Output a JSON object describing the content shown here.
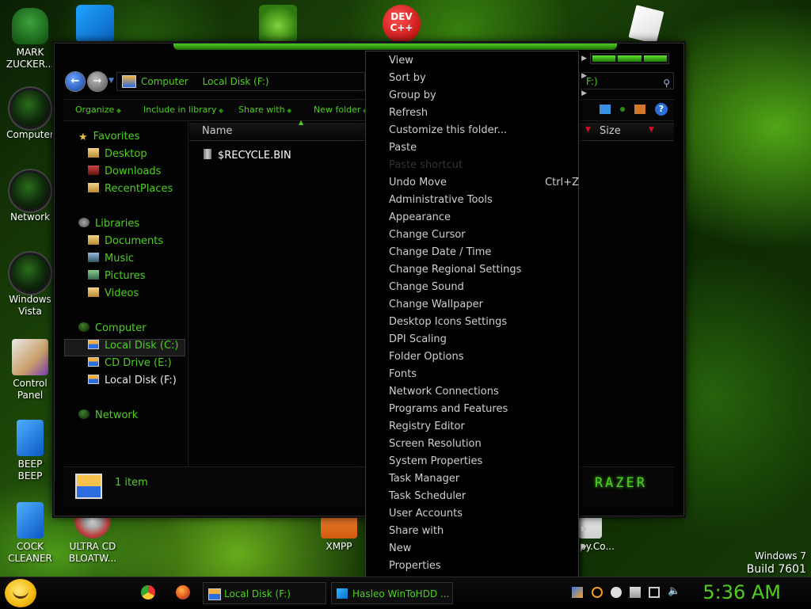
{
  "desktop": {
    "icons": [
      {
        "label": "MARK\nZUCKER..."
      },
      {
        "label": "Computer"
      },
      {
        "label": "Network"
      },
      {
        "label": "Windows\nVista"
      },
      {
        "label": "Control\nPanel"
      },
      {
        "label": "BEEP\nBEEP"
      },
      {
        "label": "COCK\nCLEANER"
      },
      {
        "label": "ULTRA CD\nBLOATW..."
      },
      {
        "label": "XMPP"
      },
      {
        "label": "py.Co..."
      }
    ],
    "top_icon_dev": "DEV\nC++",
    "watermark_line1": "Windows 7",
    "watermark_line2": "Build 7601"
  },
  "explorer": {
    "breadcrumb": [
      "Computer",
      "Local Disk (F:)"
    ],
    "search_text": "F:)",
    "toolbar": {
      "organize": "Organize",
      "include_in_library": "Include in library",
      "share_with": "Share with",
      "new_folder": "New folder"
    },
    "nav": {
      "favorites": "Favorites",
      "favorites_items": [
        "Desktop",
        "Downloads",
        "RecentPlaces"
      ],
      "libraries": "Libraries",
      "libraries_items": [
        "Documents",
        "Music",
        "Pictures",
        "Videos"
      ],
      "computer": "Computer",
      "computer_items": [
        "Local Disk (C:)",
        "CD Drive (E:)",
        "Local Disk (F:)"
      ],
      "network": "Network"
    },
    "columns": {
      "name": "Name",
      "size": "Size"
    },
    "files": [
      "$RECYCLE.BIN"
    ],
    "status": "1 item",
    "logo_text": "RAZER"
  },
  "context_menu": {
    "items": [
      {
        "label": "View",
        "submenu": true
      },
      {
        "label": "Sort by",
        "submenu": true
      },
      {
        "label": "Group by",
        "submenu": true
      },
      {
        "label": "Refresh"
      },
      {
        "label": "Customize this folder..."
      },
      {
        "label": "Paste"
      },
      {
        "label": "Paste shortcut",
        "disabled": true
      },
      {
        "label": "Undo Move",
        "shortcut": "Ctrl+Z"
      },
      {
        "label": "Administrative Tools"
      },
      {
        "label": "Appearance"
      },
      {
        "label": "Change Cursor"
      },
      {
        "label": "Change Date / Time"
      },
      {
        "label": "Change Regional Settings"
      },
      {
        "label": "Change Sound"
      },
      {
        "label": "Change Wallpaper"
      },
      {
        "label": "Desktop Icons Settings"
      },
      {
        "label": "DPI Scaling"
      },
      {
        "label": "Folder Options"
      },
      {
        "label": "Fonts"
      },
      {
        "label": "Network Connections"
      },
      {
        "label": "Programs and Features"
      },
      {
        "label": "Registry Editor"
      },
      {
        "label": "Screen Resolution"
      },
      {
        "label": "System Properties"
      },
      {
        "label": "Task Manager"
      },
      {
        "label": "Task Scheduler"
      },
      {
        "label": "User Accounts"
      },
      {
        "label": "Share with",
        "submenu": true
      },
      {
        "label": "New",
        "submenu": true
      },
      {
        "label": "Properties"
      }
    ]
  },
  "taskbar": {
    "tasks": [
      "Local Disk (F:)",
      "Hasleo WinToHDD ..."
    ],
    "clock": "5:36 AM"
  },
  "colors": {
    "accent": "#4ecf20",
    "menu_bg": "#000000",
    "menu_text": "#cfcfcf"
  }
}
